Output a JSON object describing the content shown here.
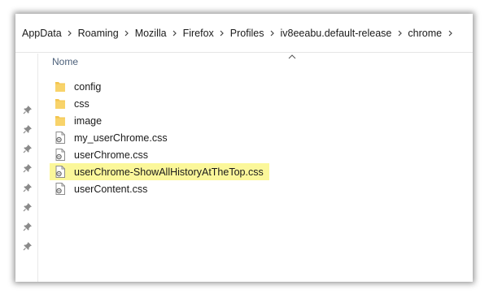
{
  "breadcrumb": {
    "items": [
      {
        "label": "AppData"
      },
      {
        "label": "Roaming"
      },
      {
        "label": "Mozilla"
      },
      {
        "label": "Firefox"
      },
      {
        "label": "Profiles"
      },
      {
        "label": "iv8eeabu.default-release"
      },
      {
        "label": "chrome"
      }
    ]
  },
  "list": {
    "column_header": "Nome",
    "items": [
      {
        "name": "config",
        "type": "folder"
      },
      {
        "name": "css",
        "type": "folder"
      },
      {
        "name": "image",
        "type": "folder"
      },
      {
        "name": "my_userChrome.css",
        "type": "css-file"
      },
      {
        "name": "userChrome.css",
        "type": "css-file"
      },
      {
        "name": "userChrome-ShowAllHistoryAtTheTop.css",
        "type": "css-file",
        "highlighted": true
      },
      {
        "name": "userContent.css",
        "type": "css-file"
      }
    ]
  },
  "nav_pane": {
    "pins": [
      "pin-icon",
      "pin-icon",
      "pin-icon",
      "pin-icon",
      "pin-icon",
      "pin-icon",
      "pin-icon",
      "pin-icon"
    ]
  },
  "colors": {
    "highlight": "#fbf79a",
    "folder": "#f3c44d",
    "header_text": "#4c607a"
  }
}
